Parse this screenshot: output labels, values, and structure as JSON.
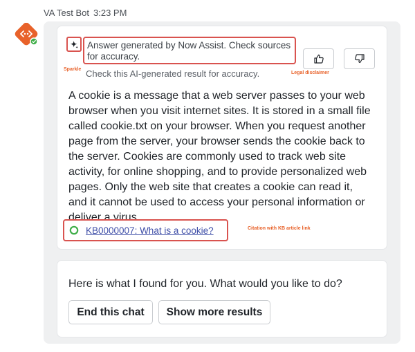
{
  "header": {
    "bot_name": "VA Test Bot",
    "time": "3:23 PM"
  },
  "annotations": {
    "sparkle": "Sparkle",
    "legal": "Legal disclaimer",
    "citation": "Citation with KB article link"
  },
  "answer_card": {
    "disclaimer": "Answer generated by Now Assist. Check sources for accuracy.",
    "sub_disclaimer": "Check this AI-generated result for accuracy.",
    "body": "A cookie is a message that a web server passes to your web browser when you visit internet sites. It is stored in a small file called cookie.txt on your browser. When you request another page from the server, your browser sends the cookie back to the server. Cookies are commonly used to track web site activity, for online shopping, and to provide personalized web pages. Only the web site that creates a cookie can read it, and it cannot be used to access your personal information or deliver a virus.",
    "citation_link": "KB0000007: What is a cookie?",
    "icons": {
      "sparkle": "sparkle-icon",
      "thumbs_up": "thumbs-up-icon",
      "thumbs_down": "thumbs-down-icon",
      "citation": "kb-article-icon"
    }
  },
  "followup_card": {
    "prompt": "Here is what I found for you. What would you like to do?",
    "buttons": {
      "end_chat": "End this chat",
      "show_more": "Show more results"
    }
  },
  "colors": {
    "brand_orange": "#e8622a",
    "annotation_red": "#d9534f",
    "link_blue": "#3f4fa8",
    "status_green": "#3fae49"
  }
}
